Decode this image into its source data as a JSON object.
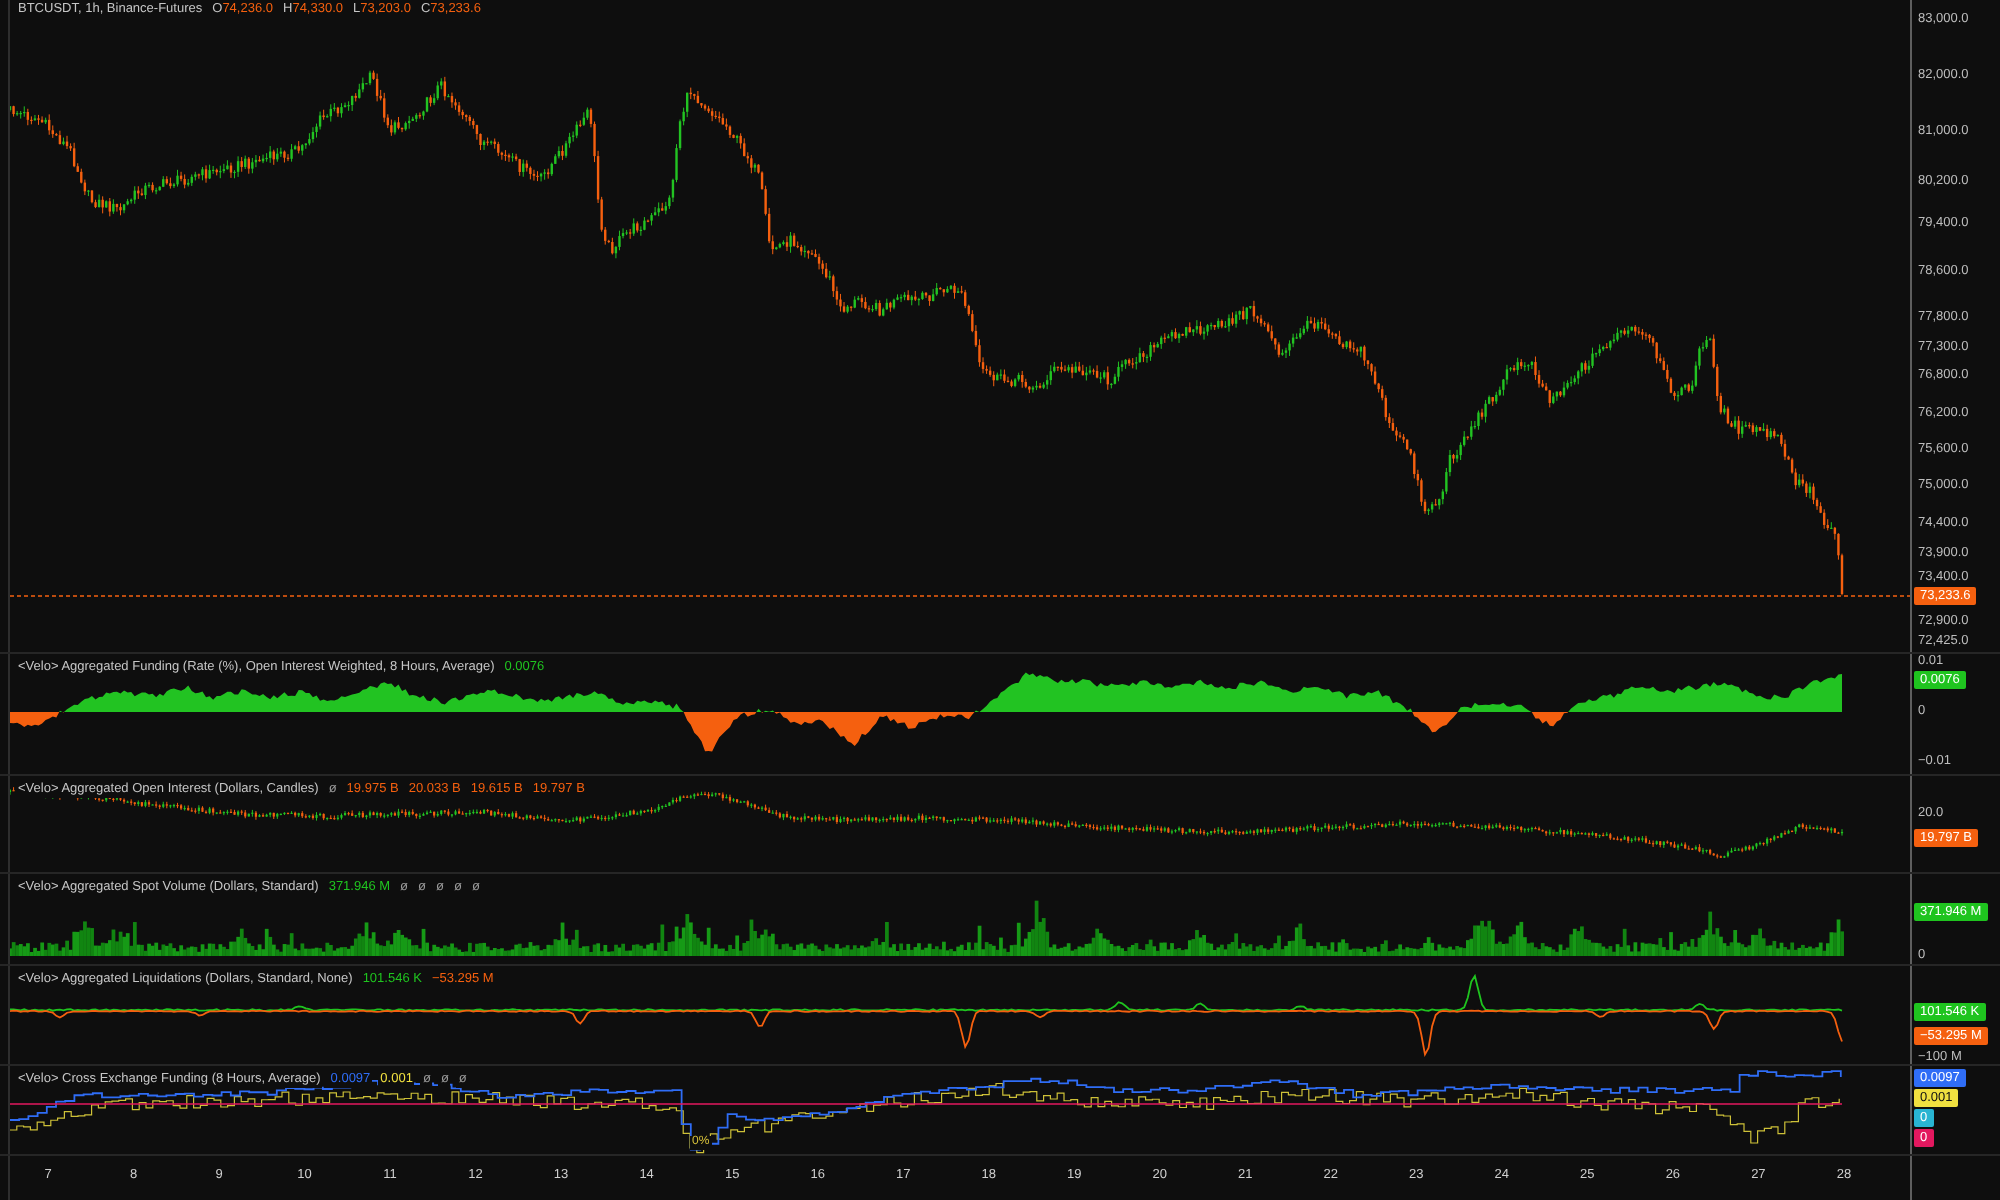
{
  "header": {
    "symbol": "BTCUSDT, 1h, Binance-Futures",
    "ohlc": [
      {
        "label": "O",
        "value": "74,236.0"
      },
      {
        "label": "H",
        "value": "74,330.0"
      },
      {
        "label": "L",
        "value": "73,203.0"
      },
      {
        "label": "C",
        "value": "73,233.6"
      }
    ]
  },
  "price_axis": {
    "ticks": [
      "83,000.0",
      "82,000.0",
      "81,000.0",
      "80,200.0",
      "79,400.0",
      "78,600.0",
      "77,800.0",
      "77,300.0",
      "76,800.0",
      "76,200.0",
      "75,600.0",
      "75,000.0",
      "74,400.0",
      "73,900.0",
      "73,400.0",
      "72,900.0",
      "72,425.0"
    ],
    "last_price": "73,233.6"
  },
  "indicators": [
    {
      "kind": "funding",
      "title": "<Velo> Aggregated Funding (Rate (%), Open Interest Weighted, 8 Hours, Average)",
      "values": [
        {
          "text": "0.0076",
          "color": "#1fc41f"
        }
      ],
      "axis_labels": [
        "0.01",
        "0",
        "−0.01"
      ],
      "badges": [
        {
          "text": "0.0076",
          "color": "#1fc41f"
        }
      ]
    },
    {
      "kind": "candles",
      "title": "<Velo> Aggregated Open Interest (Dollars, Candles)",
      "values": [
        {
          "text": "ø",
          "color": "#9a9a9a"
        },
        {
          "text": "19.975 B",
          "color": "#f5600f"
        },
        {
          "text": "20.033 B",
          "color": "#f5600f"
        },
        {
          "text": "19.615 B",
          "color": "#f5600f"
        },
        {
          "text": "19.797 B",
          "color": "#f5600f"
        }
      ],
      "axis_labels": [
        "20.0"
      ],
      "badges": [
        {
          "text": "19.797 B",
          "color": "#f5600f"
        }
      ]
    },
    {
      "kind": "bars",
      "title": "<Velo> Aggregated Spot Volume (Dollars, Standard)",
      "values": [
        {
          "text": "371.946 M",
          "color": "#1fc41f"
        },
        {
          "text": "ø",
          "color": "#9a9a9a"
        },
        {
          "text": "ø",
          "color": "#9a9a9a"
        },
        {
          "text": "ø",
          "color": "#9a9a9a"
        },
        {
          "text": "ø",
          "color": "#9a9a9a"
        },
        {
          "text": "ø",
          "color": "#9a9a9a"
        }
      ],
      "axis_labels": [
        "0"
      ],
      "badges": [
        {
          "text": "371.946 M",
          "color": "#1fc41f"
        }
      ]
    },
    {
      "kind": "liquidations",
      "title": "<Velo> Aggregated Liquidations (Dollars, Standard, None)",
      "values": [
        {
          "text": "101.546 K",
          "color": "#1fc41f"
        },
        {
          "text": "−53.295 M",
          "color": "#f5600f"
        }
      ],
      "axis_labels": [
        "−100 M"
      ],
      "badges": [
        {
          "text": "101.546 K",
          "color": "#1fc41f"
        },
        {
          "text": "−53.295 M",
          "color": "#f5600f"
        }
      ]
    },
    {
      "kind": "cross_funding",
      "title": "<Velo> Cross Exchange Funding (8 Hours, Average)",
      "values": [
        {
          "text": "0.0097",
          "color": "#2f6df6"
        },
        {
          "text": "0.001",
          "color": "#f0e040"
        },
        {
          "text": "ø",
          "color": "#9a9a9a"
        },
        {
          "text": "ø",
          "color": "#9a9a9a"
        },
        {
          "text": "ø",
          "color": "#9a9a9a"
        }
      ],
      "badges": [
        {
          "text": "0.0097",
          "color": "#2f6df6"
        },
        {
          "text": "0.001",
          "color": "#f0e040"
        },
        {
          "text": "0",
          "color": "#28b4d2"
        },
        {
          "text": "0",
          "color": "#e3185f"
        }
      ],
      "note": "0%"
    }
  ],
  "time_axis": {
    "labels": [
      "7",
      "8",
      "9",
      "10",
      "11",
      "12",
      "13",
      "14",
      "15",
      "16",
      "17",
      "18",
      "19",
      "20",
      "21",
      "22",
      "23",
      "24",
      "25",
      "26",
      "27",
      "28"
    ]
  }
}
